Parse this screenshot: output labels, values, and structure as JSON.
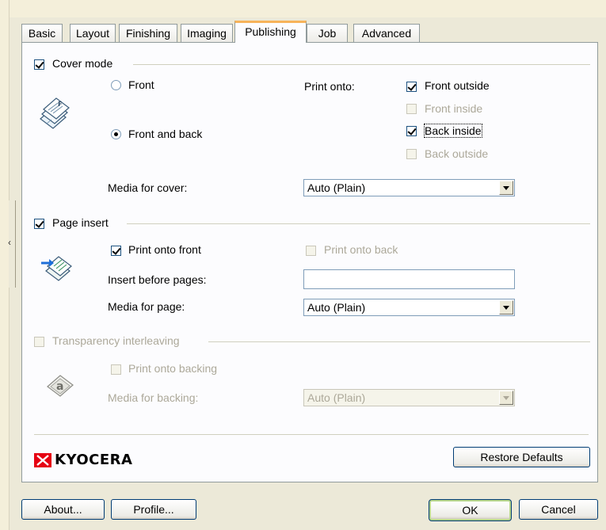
{
  "tabs": [
    "Basic",
    "Layout",
    "Finishing",
    "Imaging",
    "Publishing",
    "Job",
    "Advanced"
  ],
  "active_tab": "Publishing",
  "cover_mode": {
    "label": "Cover mode",
    "checked": true,
    "front_label": "Front",
    "front_and_back_label": "Front and back",
    "selected": "Front and back",
    "print_onto_label": "Print onto:",
    "front_outside_label": "Front outside",
    "front_inside_label": "Front inside",
    "back_inside_label": "Back inside",
    "back_outside_label": "Back outside",
    "media_label": "Media for cover:",
    "media_value": "Auto (Plain)"
  },
  "page_insert": {
    "label": "Page insert",
    "checked": true,
    "print_onto_front_label": "Print onto front",
    "print_onto_back_label": "Print onto back",
    "insert_before_label": "Insert before pages:",
    "insert_before_value": "",
    "media_label": "Media for page:",
    "media_value": "Auto (Plain)"
  },
  "transparency": {
    "label": "Transparency interleaving",
    "print_onto_backing_label": "Print onto backing",
    "media_label": "Media for backing:",
    "media_value": "Auto (Plain)"
  },
  "brand": {
    "logo_text": "KYOCERA",
    "color": "#E60012"
  },
  "buttons": {
    "restore_defaults": "Restore Defaults",
    "about": "About...",
    "profile": "Profile...",
    "ok": "OK",
    "cancel": "Cancel"
  },
  "colors": {
    "dialog_bg": "#ECE9D8",
    "panel_bg": "#FCFCFE",
    "active_tab_accent": "#F7B35A"
  }
}
